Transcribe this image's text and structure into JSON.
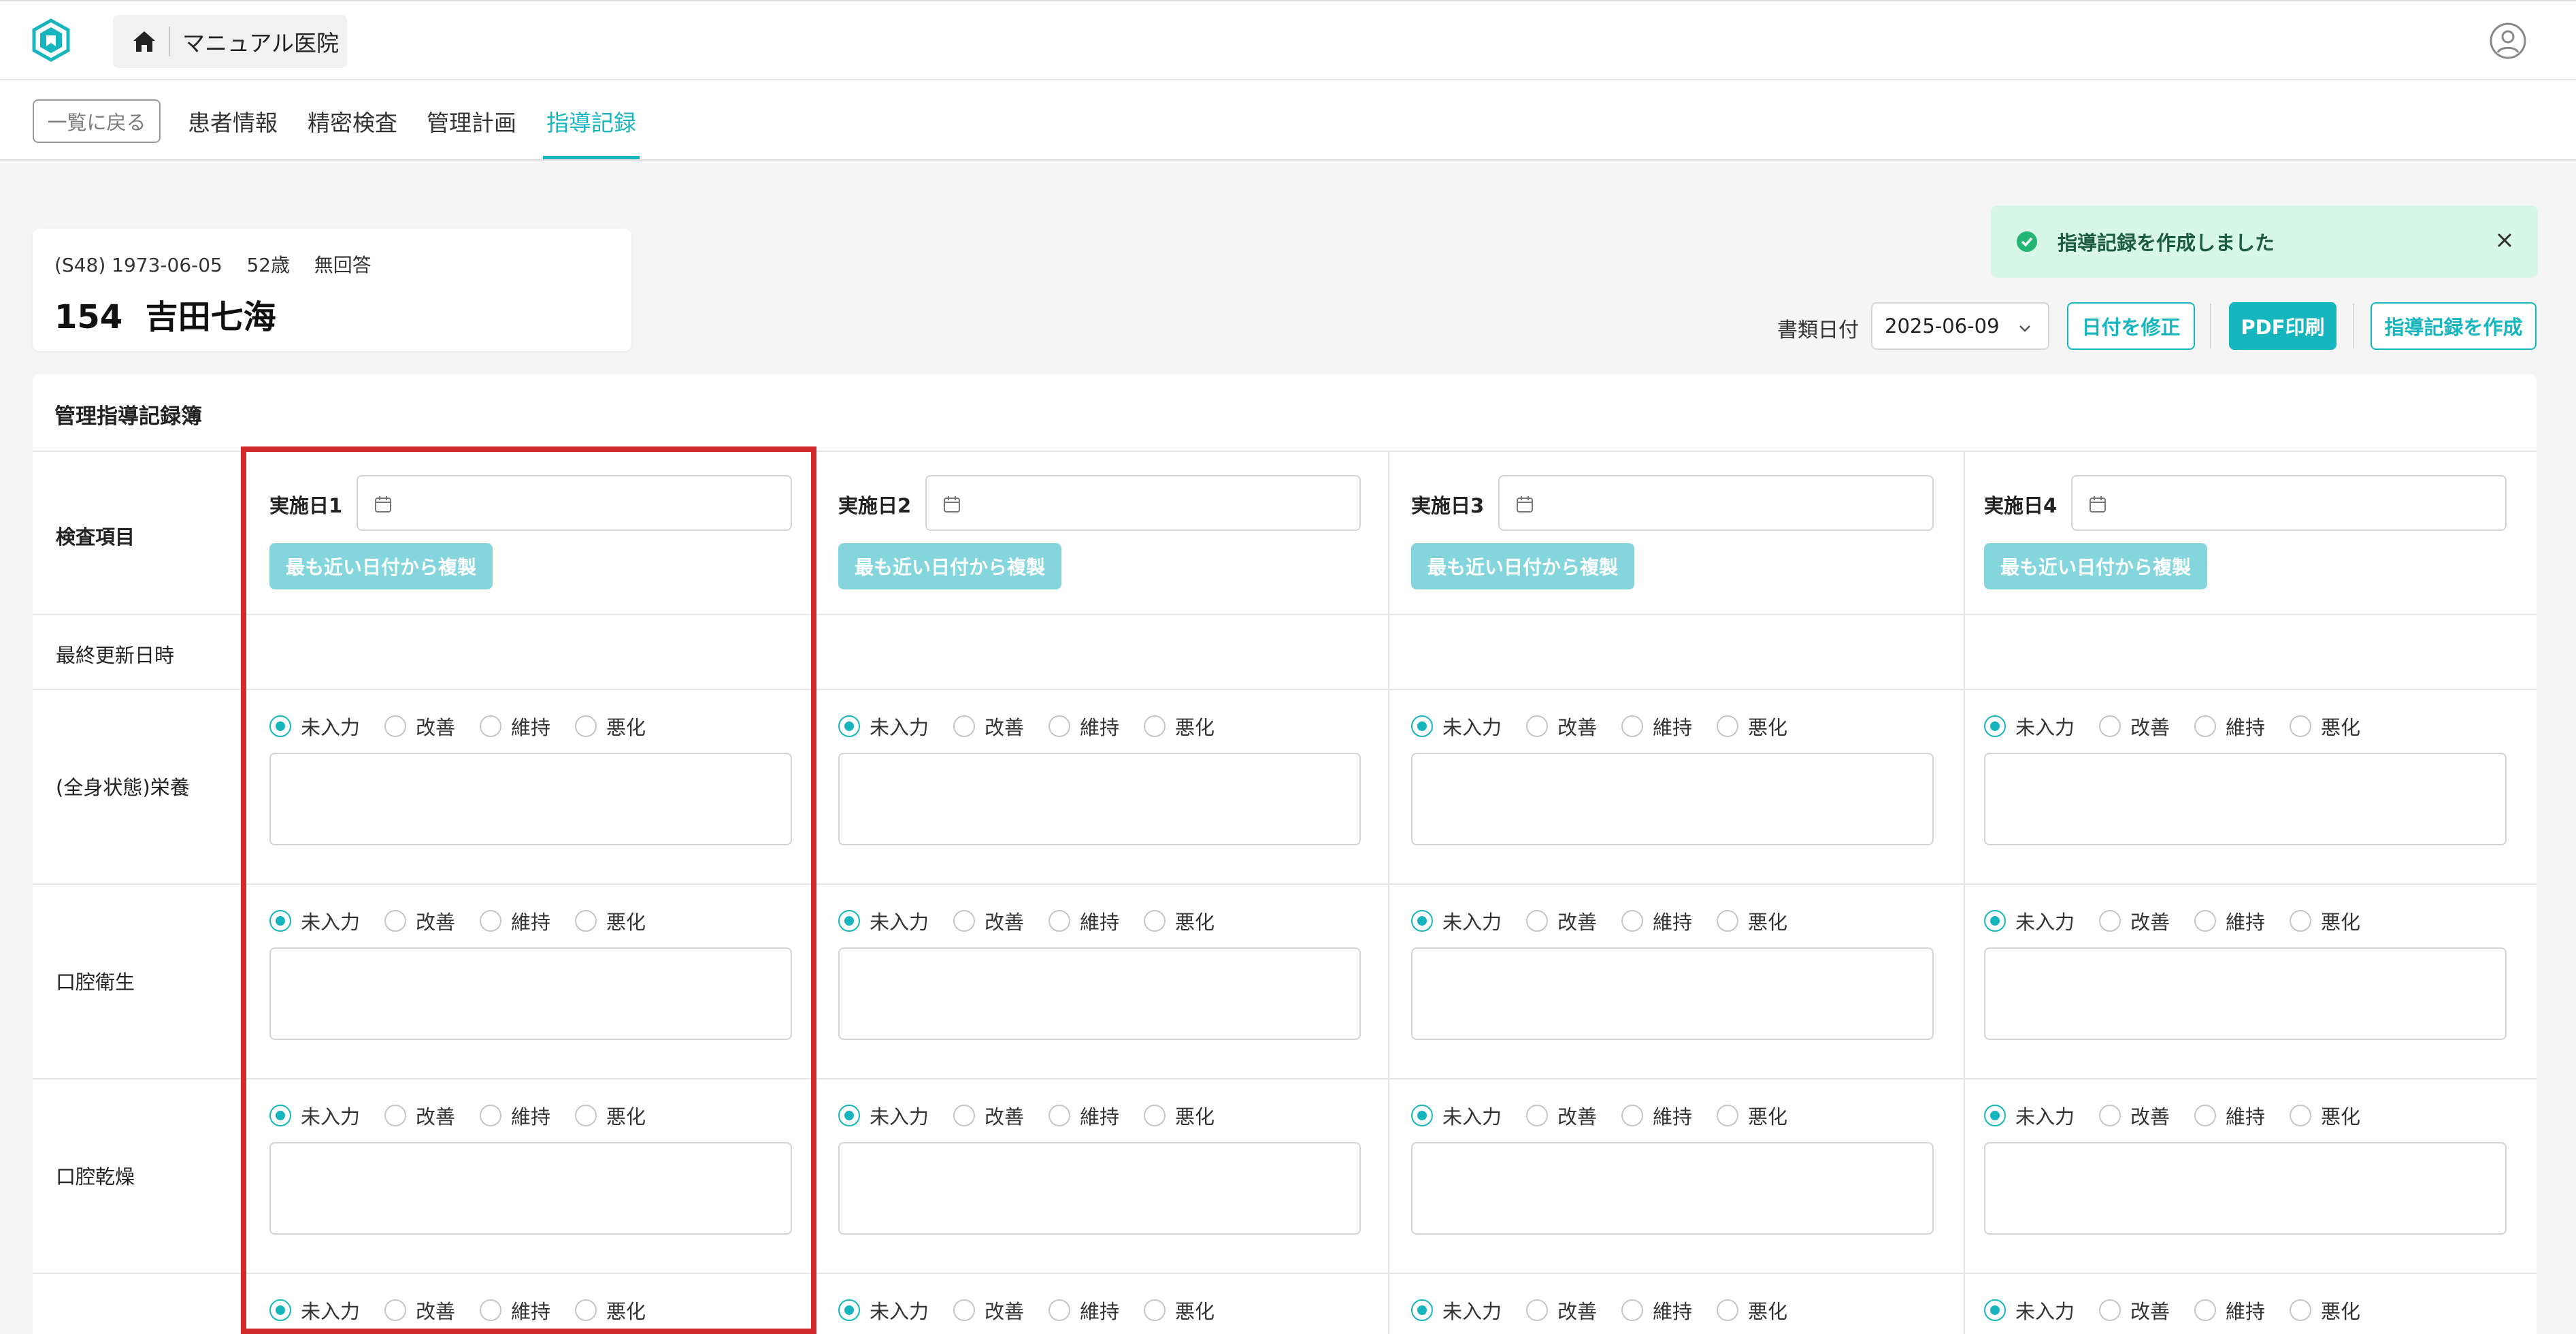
{
  "header": {
    "clinic_name": "マニュアル医院"
  },
  "nav": {
    "back_label": "一覧に戻る",
    "tabs": [
      "患者情報",
      "精密検査",
      "管理計画",
      "指導記録"
    ],
    "active_tab": "指導記録"
  },
  "patient": {
    "meta": "(S48) 1973-06-05    52歳    無回答",
    "name": "154  吉田七海"
  },
  "toast": {
    "message": "指導記録を作成しました"
  },
  "toolbar": {
    "doc_date_label": "書類日付",
    "doc_date_value": "2025-06-09",
    "fix_date_label": "日付を修正",
    "pdf_label": "PDF印刷",
    "create_label": "指導記録を作成"
  },
  "panel": {
    "title": "管理指導記録簿",
    "item_header": "検査項目",
    "last_updated_label": "最終更新日時",
    "columns": [
      "実施日1",
      "実施日2",
      "実施日3",
      "実施日4"
    ],
    "copy_label": "最も近い日付から複製",
    "rows": [
      "(全身状態)栄養",
      "口腔衛生",
      "口腔乾燥"
    ],
    "radio_options": [
      "未入力",
      "改善",
      "維持",
      "悪化"
    ],
    "selected_option": "未入力"
  },
  "colors": {
    "accent": "#17b5bd",
    "highlight": "#d22a2a",
    "toast_bg": "#d7f7e9"
  }
}
